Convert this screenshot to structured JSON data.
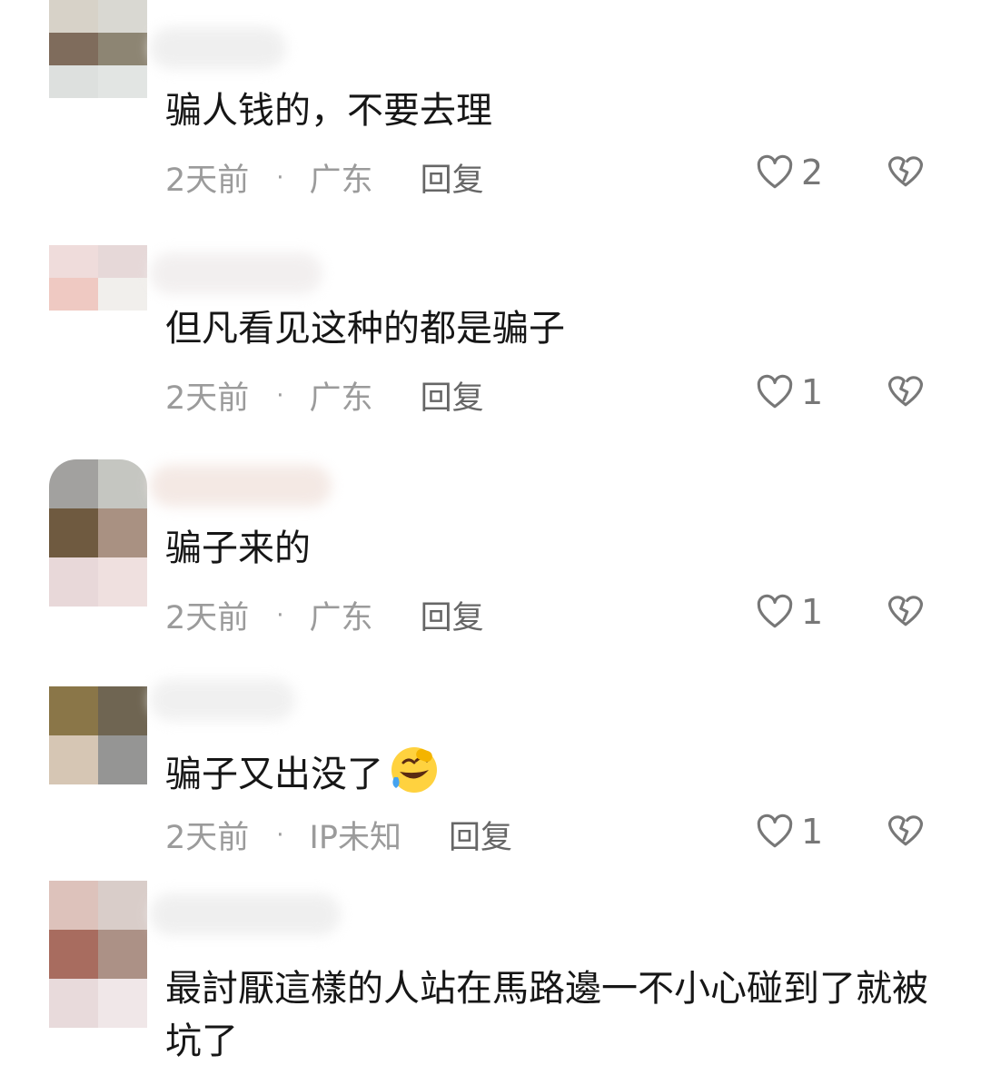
{
  "comments": [
    {
      "text": "骗人钱的，不要去理",
      "time": "2天前",
      "location": "广东",
      "reply": "回复",
      "likes": "2",
      "avatar": [
        "#d7d2c8",
        "#d9d8d2",
        "#7f6c5c",
        "#8d8573",
        "#dde0de",
        "#e2e5e3"
      ],
      "name_blur": [
        "#eeeeee",
        "#f2f2f2"
      ]
    },
    {
      "text": "但凡看见这种的都是骗子",
      "time": "2天前",
      "location": "广东",
      "reply": "回复",
      "likes": "1",
      "avatar": [
        "#efdcdb",
        "#e6d8d8",
        "#efc9c2",
        "#f1efec",
        "#ffffff",
        "#ffffff"
      ],
      "name_blur": [
        "#f1eeee",
        "#f4f3f3"
      ]
    },
    {
      "text": "骗子来的",
      "time": "2天前",
      "location": "广东",
      "reply": "回复",
      "likes": "1",
      "avatar": [
        "#a2a19f",
        "#c5c6c1",
        "#6f5a40",
        "#a99182",
        "#e8d8d9",
        "#efe0df"
      ],
      "name_blur": [
        "#f3e7e2",
        "#f6f0ef"
      ]
    },
    {
      "text": "骗子又出没了",
      "emoji": "laugh-cry",
      "time": "2天前",
      "location": "IP未知",
      "reply": "回复",
      "likes": "1",
      "avatar": [
        "#8a7648",
        "#6f6552",
        "#d6c6b4",
        "#959594",
        "#ffffff",
        "#ffffff"
      ],
      "name_blur": [
        "#efefef",
        "#f3f3f3"
      ]
    },
    {
      "text": "最討厭這樣的人站在馬路邊一不小心碰到了就被坑了",
      "avatar": [
        "#ddc2bb",
        "#d9cdc9",
        "#a86c5f",
        "#ac9186",
        "#e8dadb",
        "#f0e7e8"
      ],
      "name_blur": [
        "#eeeeee",
        "#f3f3f3"
      ]
    }
  ],
  "colors": {
    "text": "#161616",
    "meta": "#9b9b9b",
    "icon": "#777777"
  }
}
